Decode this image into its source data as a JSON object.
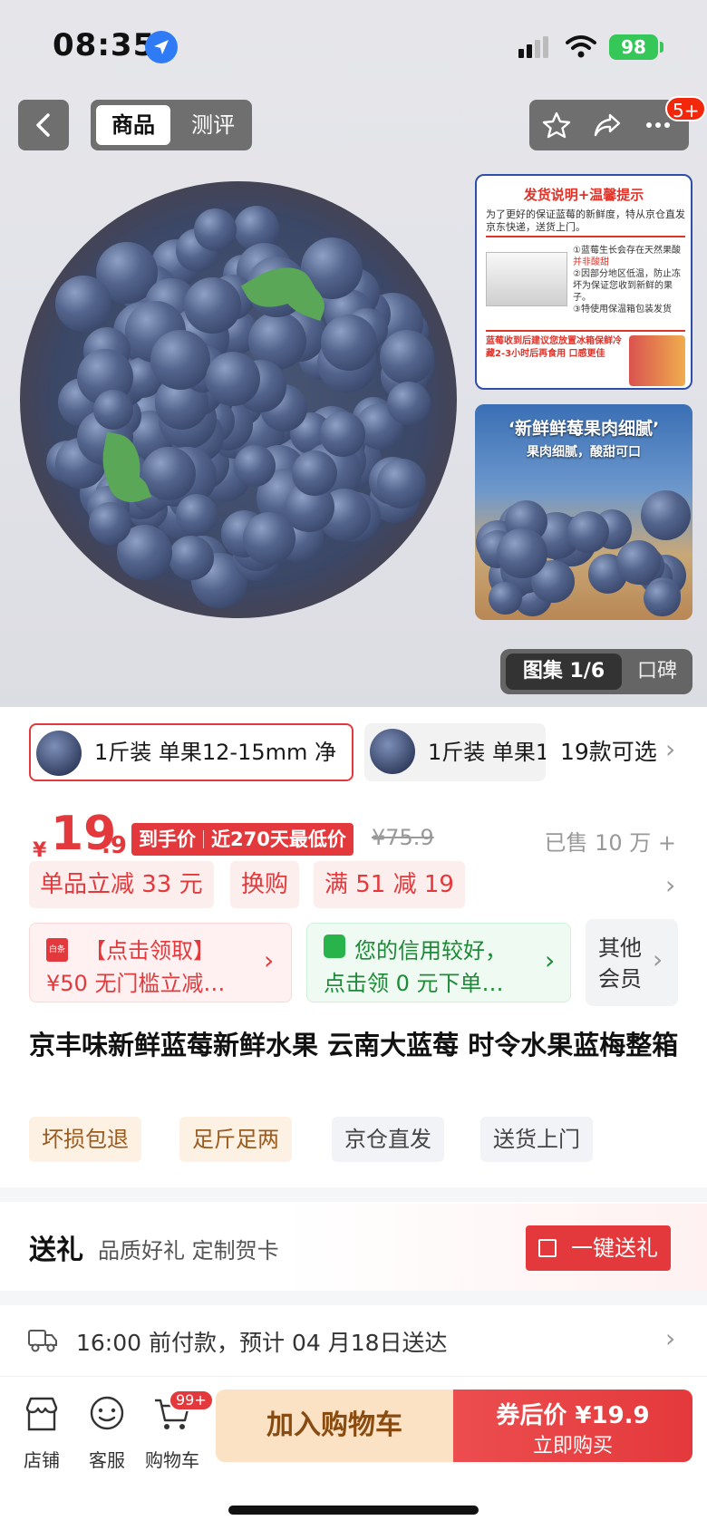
{
  "status_bar": {
    "time": "08:35",
    "battery": "98"
  },
  "nav": {
    "tab_active": "商品",
    "tab_inactive": "测评",
    "more_badge": "5+"
  },
  "gallery": {
    "thumb1": {
      "title": "发货说明+温馨提示",
      "subtitle": "为了更好的保证蓝莓的新鲜度，特从京仓直发京东快递，送货上门。",
      "tip1": "①蓝莓生长会存在天然果酸",
      "tip1_red": "并非酸甜",
      "tip2": "②因部分地区低温，防止冻坏为保证您收到新鲜的果子。",
      "tip3": "③特使用保温箱包装发货",
      "footer": "蓝莓收到后建议您放置冰箱保鲜冷藏2-3小时后再食用 口感更佳"
    },
    "thumb2": {
      "headline": "‘新鲜鲜莓果肉细腻’",
      "sub": "果肉细腻，酸甜可口"
    },
    "counter_active": "图集 1/6",
    "counter_other": "口碑"
  },
  "sku": {
    "option1": "1斤装 单果12-15mm 净",
    "option2": "1斤装 单果1",
    "more": "19款可选"
  },
  "price": {
    "currency": "¥",
    "integer": "19",
    "decimal": ".9",
    "tag_left": "到手价",
    "tag_right": "近270天最低价",
    "original": "¥75.9",
    "sold": "已售 10 万 +"
  },
  "promos": [
    "单品立减 33 元",
    "换购",
    "满 51 减 19"
  ],
  "coupons": {
    "c1_tag": "白条",
    "c1_line1": "【点击领取】",
    "c1_line2": "¥50 无门槛立减…",
    "c2_line1": "您的信用较好，",
    "c2_line2": "点击领 0 元下单…",
    "c3_line1": "其他",
    "c3_line2": "会员"
  },
  "product_title": "京丰味新鲜蓝莓新鲜水果 云南大蓝莓 时令水果蓝梅整箱",
  "service_tags": [
    "坏损包退",
    "足斤足两",
    "京仓直发",
    "送货上门"
  ],
  "gift": {
    "heading": "送礼",
    "desc": "品质好礼 定制贺卡",
    "button": "一键送礼"
  },
  "shipping": {
    "line1": "16:00 前付款，预计 04 月18日送达"
  },
  "bottom_bar": {
    "shop": "店铺",
    "service": "客服",
    "cart": "购物车",
    "cart_badge": "99+",
    "add_to_cart": "加入购物车",
    "buy_price_label": "券后价 ¥19.9",
    "buy_now": "立即购买"
  },
  "colors": {
    "accent": "#e4393c",
    "cart_bg": "#fbe2c4",
    "green": "#1c8a36"
  }
}
